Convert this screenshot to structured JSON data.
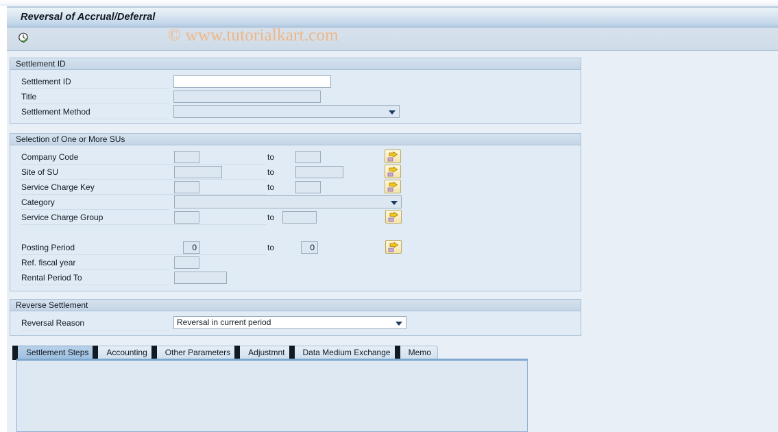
{
  "window": {
    "title": "Reversal of Accrual/Deferral",
    "watermark": "© www.tutorialkart.com"
  },
  "toolbar": {
    "execute_button": "execute",
    "execute_icon": "clock-check-icon"
  },
  "sections": {
    "settlement_id": {
      "header": "Settlement ID",
      "fields": [
        {
          "label": "Settlement ID",
          "value": "",
          "type": "text",
          "editable": true
        },
        {
          "label": "Title",
          "value": "",
          "type": "text",
          "editable": false
        },
        {
          "label": "Settlement Method",
          "value": "",
          "type": "select",
          "editable": false
        }
      ]
    },
    "selection_sus": {
      "header": "Selection of One or More SUs",
      "to_label": "to",
      "fields": [
        {
          "label": "Company Code",
          "from": "",
          "to": "",
          "type": "range",
          "has_multi": true
        },
        {
          "label": "Site of SU",
          "from": "",
          "to": "",
          "type": "range",
          "has_multi": true
        },
        {
          "label": "Service Charge Key",
          "from": "",
          "to": "",
          "type": "range",
          "has_multi": true
        },
        {
          "label": "Category",
          "value": "",
          "type": "select",
          "has_multi": false
        },
        {
          "label": "Service Charge Group",
          "from": "",
          "to": "",
          "type": "range",
          "has_multi": true
        },
        {
          "label": "Posting Period",
          "from": "0",
          "to": "0",
          "type": "range",
          "has_multi": true
        },
        {
          "label": "Ref. fiscal year",
          "from": "",
          "type": "single",
          "has_multi": false
        },
        {
          "label": "Rental Period To",
          "from": "",
          "type": "single",
          "has_multi": false
        }
      ]
    },
    "reverse_settlement": {
      "header": "Reverse Settlement",
      "fields": [
        {
          "label": "Reversal Reason",
          "value": "Reversal in current period",
          "type": "select",
          "editable": true
        }
      ]
    }
  },
  "tabs": {
    "items": [
      {
        "label": "Settlement Steps",
        "active": true
      },
      {
        "label": "Accounting",
        "active": false
      },
      {
        "label": "Other Parameters",
        "active": false
      },
      {
        "label": "Adjustmnt",
        "active": false
      },
      {
        "label": "Data Medium Exchange",
        "active": false
      },
      {
        "label": "Memo",
        "active": false
      }
    ]
  },
  "colors": {
    "page_bg": "#e9eff7",
    "panel_bg": "#e1ebf5",
    "accent_tab_active": "#a8c6e3",
    "watermark": "#f0b684",
    "multi_button": "#faeec0"
  }
}
